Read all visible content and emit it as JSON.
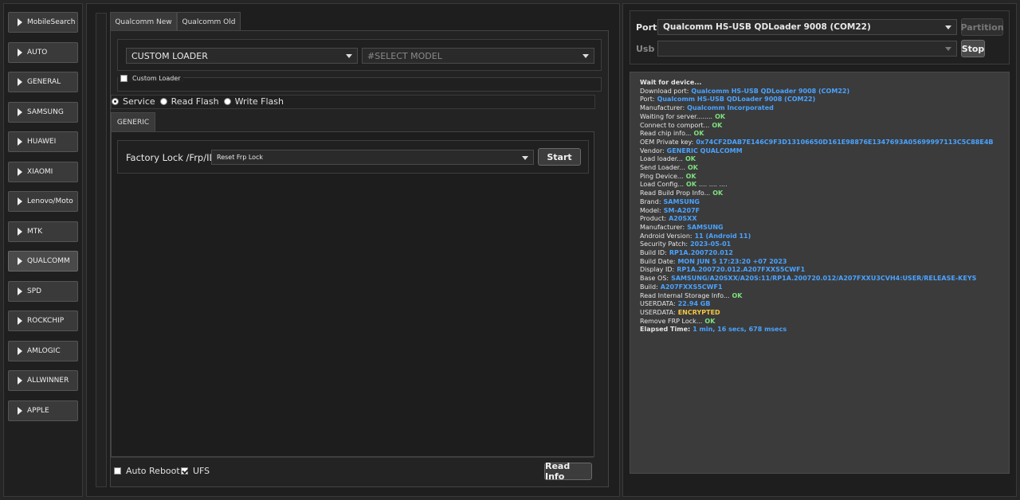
{
  "sidebar": {
    "items": [
      {
        "label": "MobileSearch",
        "active": false
      },
      {
        "label": "AUTO",
        "active": false
      },
      {
        "label": "GENERAL",
        "active": false
      },
      {
        "label": "SAMSUNG",
        "active": false
      },
      {
        "label": "HUAWEI",
        "active": false
      },
      {
        "label": "XIAOMI",
        "active": false
      },
      {
        "label": "Lenovo/Moto",
        "active": false
      },
      {
        "label": "MTK",
        "active": false
      },
      {
        "label": "QUALCOMM",
        "active": true
      },
      {
        "label": "SPD",
        "active": false
      },
      {
        "label": "ROCKCHIP",
        "active": false
      },
      {
        "label": "AMLOGIC",
        "active": false
      },
      {
        "label": "ALLWINNER",
        "active": false
      },
      {
        "label": "APPLE",
        "active": false
      }
    ]
  },
  "center": {
    "tabs": [
      {
        "label": "Qualcomm New",
        "active": true
      },
      {
        "label": "Qualcomm Old",
        "active": false
      }
    ],
    "loader_select": "CUSTOM LOADER",
    "model_select_placeholder": "#SELECT MODEL",
    "custom_loader_label": "Custom Loader",
    "custom_loader_checked": false,
    "modes": [
      {
        "label": "Service",
        "checked": true
      },
      {
        "label": "Read Flash",
        "checked": false
      },
      {
        "label": "Write Flash",
        "checked": false
      }
    ],
    "sub_tab": "GENERIC",
    "operation_label": "Factory Lock /Frp/ID",
    "operation_select": "Reset Frp Lock",
    "start_button": "Start",
    "auto_reboot_label": "Auto Reboot",
    "auto_reboot_checked": false,
    "ufs_label": "UFS",
    "ufs_checked": true,
    "read_info_button": "Read Info"
  },
  "right": {
    "port_label": "Port",
    "port_value": "Qualcomm HS-USB QDLoader 9008 (COM22)",
    "partition_button": "Partition",
    "usb_label": "Usb",
    "usb_value": "",
    "stop_button": "Stop"
  },
  "log": [
    {
      "text": "Wait for device...",
      "bold": true
    },
    {
      "text": "Download port:",
      "value": "Qualcomm HS-USB QDLoader 9008 (COM22)",
      "color": "#4aa3ff"
    },
    {
      "text": "Port:",
      "value": "Qualcomm HS-USB QDLoader 9008 (COM22)",
      "color": "#4aa3ff"
    },
    {
      "text": "Manufacturer:",
      "value": "Qualcomm Incorporated",
      "color": "#4aa3ff"
    },
    {
      "text": "Waiting for server........",
      "value": "OK",
      "color": "#7de07d"
    },
    {
      "text": "Connect to comport...",
      "value": "OK",
      "color": "#7de07d"
    },
    {
      "text": "Read chip info...",
      "value": "OK",
      "color": "#7de07d"
    },
    {
      "text": "OEM Private key:",
      "value": "0x74CF2DAB7E146C9F3D13106650D161E98876E1347693A05699997113C5C88E4B",
      "color": "#4aa3ff"
    },
    {
      "text": "Vendor:",
      "value": "GENERIC QUALCOMM",
      "color": "#4aa3ff"
    },
    {
      "text": "Load loader...",
      "value": "OK",
      "color": "#7de07d"
    },
    {
      "text": "Send Loader...",
      "value": "OK",
      "color": "#7de07d"
    },
    {
      "text": "Ping Device...",
      "value": "OK",
      "color": "#7de07d"
    },
    {
      "text": "Load Config...",
      "value": "OK",
      "color": "#7de07d",
      "suffix": ".... .... ...."
    },
    {
      "text": "Read Build Prop Info...",
      "value": "OK",
      "color": "#7de07d"
    },
    {
      "text": " Brand:",
      "value": "SAMSUNG",
      "color": "#4aa3ff"
    },
    {
      "text": " Model:",
      "value": "SM-A207F",
      "color": "#4aa3ff"
    },
    {
      "text": " Product:",
      "value": "A20SXX",
      "color": "#4aa3ff"
    },
    {
      "text": " Manufacturer:",
      "value": "SAMSUNG",
      "color": "#4aa3ff"
    },
    {
      "text": " Android Version:",
      "value": "11 (Android 11)",
      "color": "#4aa3ff"
    },
    {
      "text": " Security Patch:",
      "value": "2023-05-01",
      "color": "#4aa3ff"
    },
    {
      "text": " Build ID:",
      "value": "RP1A.200720.012",
      "color": "#4aa3ff"
    },
    {
      "text": " Build Date:",
      "value": "MON JUN  5 17:23:20 +07 2023",
      "color": "#4aa3ff"
    },
    {
      "text": " Display ID:",
      "value": "RP1A.200720.012.A207FXXS5CWF1",
      "color": "#4aa3ff"
    },
    {
      "text": " Base OS:",
      "value": "SAMSUNG/A20SXX/A20S:11/RP1A.200720.012/A207FXXU3CVH4:USER/RELEASE-KEYS",
      "color": "#4aa3ff"
    },
    {
      "text": " Build:",
      "value": "A207FXXS5CWF1",
      "color": "#4aa3ff"
    },
    {
      "text": "Read Internal Storage Info...",
      "value": "OK",
      "color": "#7de07d"
    },
    {
      "text": "USERDATA:",
      "value": "22.94 GB",
      "color": "#4aa3ff"
    },
    {
      "text": "USERDATA:",
      "value": "ENCRYPTED",
      "color": "#f5c542"
    },
    {
      "text": "Remove FRP Lock...",
      "value": "OK",
      "color": "#7de07d"
    },
    {
      "text": "Elapsed Time:",
      "value": "1 min, 16 secs, 678 msecs",
      "color": "#4aa3ff",
      "bold": true
    }
  ]
}
